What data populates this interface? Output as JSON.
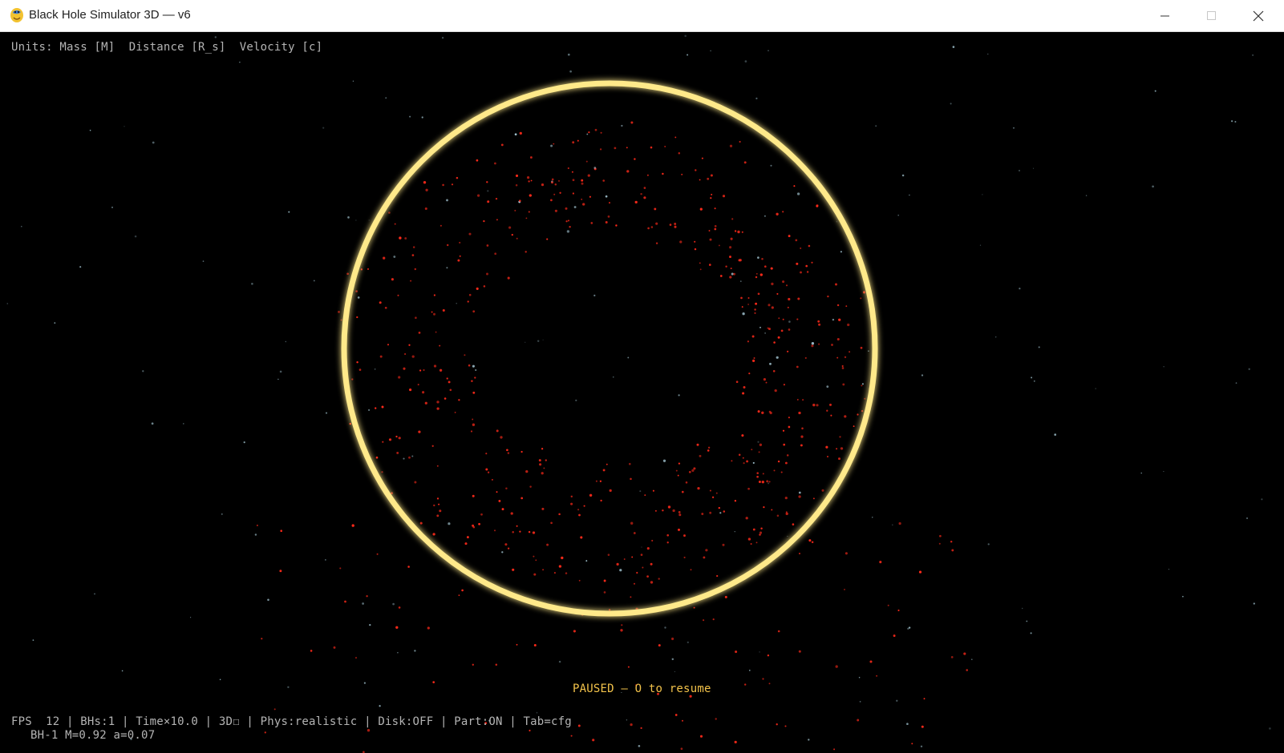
{
  "window": {
    "title": "Black Hole Simulator 3D — v6",
    "icon": "python-snake-icon",
    "controls": [
      "minimize-icon",
      "maximize-icon",
      "close-icon"
    ]
  },
  "hud": {
    "units": "Units: Mass [M]  Distance [R_s]  Velocity [c]",
    "status": "FPS  12 | BHs:1 | Time×10.0 | 3D☐ | Phys:realistic | Disk:OFF | Part:ON | Tab=cfg",
    "bh_info": "BH-1 M=0.92 a=0.07",
    "paused": "PAUSED — O to resume"
  },
  "scene": {
    "paused": true,
    "ring_color": "#ffe98a",
    "ring_glow": "#ffcc40",
    "particle_color": "#ff2a1a",
    "star_color": "#9fc0cc"
  }
}
